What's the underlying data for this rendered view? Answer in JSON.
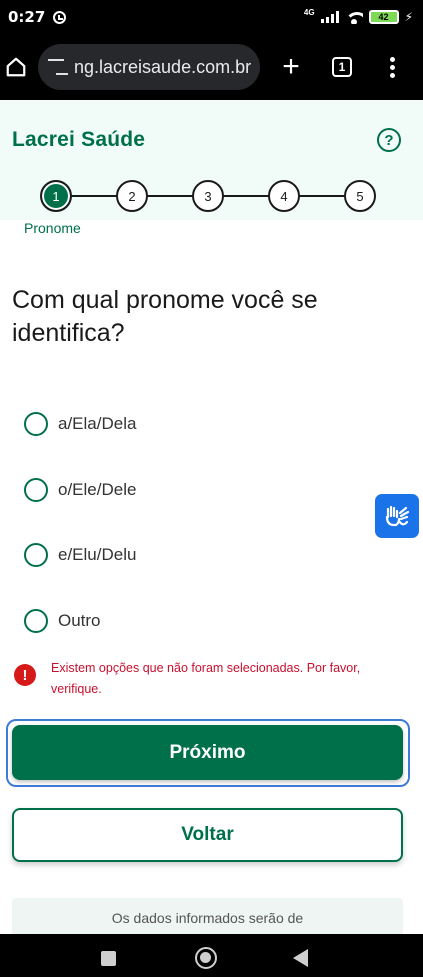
{
  "status_bar": {
    "time": "0:27",
    "network": "4G",
    "battery": "42"
  },
  "browser": {
    "url": "ng.lacreisaude.com.br",
    "tab_count": "1",
    "new_tab_label": "+"
  },
  "app": {
    "brand": "Lacrei Saúde",
    "help_symbol": "?",
    "steps": [
      "1",
      "2",
      "3",
      "4",
      "5"
    ],
    "active_step_index": 0,
    "step_label": "Pronome"
  },
  "form": {
    "question": "Com qual pronome você se identifica?",
    "options": [
      "a/Ela/Dela",
      "o/Ele/Dele",
      "e/Elu/Delu",
      "Outro"
    ],
    "error_symbol": "!",
    "error_text": "Existem opções que não foram selecionadas. Por favor, verifique.",
    "next_label": "Próximo",
    "back_label": "Voltar",
    "info_text": "Os dados informados serão de"
  },
  "colors": {
    "brand_green": "#00704a",
    "error_red": "#c8102e",
    "focus_blue": "#3d7bd9",
    "libras_blue": "#1a73e8"
  },
  "icons": {
    "home": "home-icon",
    "tune": "tune-icon",
    "help": "help-icon",
    "libras": "sign-language-hands-icon",
    "error": "error-alert-icon"
  }
}
